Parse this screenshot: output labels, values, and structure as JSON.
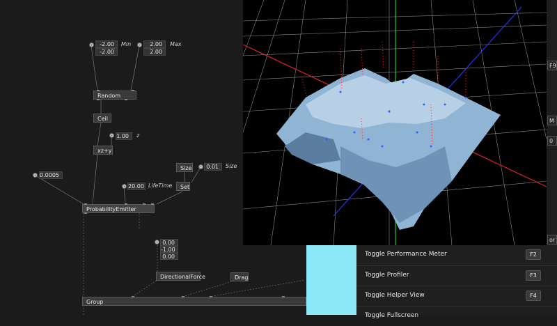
{
  "graph": {
    "random_min": {
      "v1": "-2.00",
      "v2": "-2.00",
      "label": "Min"
    },
    "random_max": {
      "v1": "2.00",
      "v2": "2.00",
      "label": "Max"
    },
    "random_node": "Random",
    "ceil_node": "Ceil",
    "z_value": "1.00",
    "z_label": "z",
    "xzy_node": "xz+y",
    "rate_value": "0.0005",
    "lifetime_value": "20.00",
    "lifetime_label": "LifeTime",
    "size_node": "Size",
    "size_value": "0.01",
    "size_label": "Size",
    "set_node": "Set",
    "emitter_node": "ProbabilityEmitter",
    "force_values": [
      "0.00",
      "-1.00",
      "0.00"
    ],
    "force_node": "DirectionalForce",
    "drag_node": "Drag",
    "group_node": "Group"
  },
  "viewport": {
    "axis_colors": {
      "x": "#e02020",
      "y": "#22cc22",
      "z": "#2233ee"
    },
    "surface_color": "#8fb4d4"
  },
  "strip": {
    "keys": [
      "F9",
      "M",
      "0",
      "or"
    ]
  },
  "menu": {
    "items": [
      {
        "label": "Toggle Performance Meter",
        "key": "F2"
      },
      {
        "label": "Toggle Profiler",
        "key": "F3"
      },
      {
        "label": "Toggle Helper View",
        "key": "F4"
      },
      {
        "label": "Toggle Fullscreen",
        "key": ""
      }
    ]
  }
}
